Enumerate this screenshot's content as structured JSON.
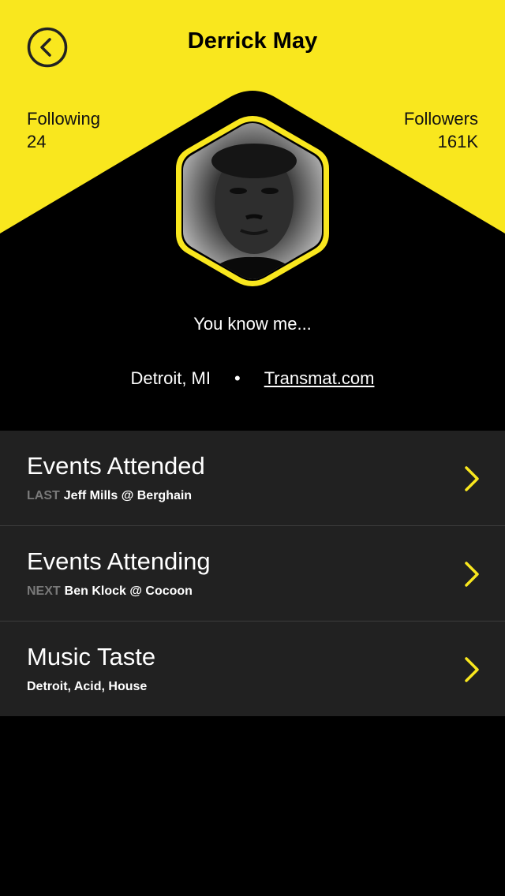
{
  "colors": {
    "accent": "#F9E71E",
    "background": "#000000",
    "row": "#212121"
  },
  "header": {
    "title": "Derrick May",
    "back_icon": "chevron-left-icon"
  },
  "stats": {
    "following": {
      "label": "Following",
      "value": "24"
    },
    "followers": {
      "label": "Followers",
      "value": "161K"
    }
  },
  "profile": {
    "tagline": "You know me...",
    "location": "Detroit, MI",
    "separator": "•",
    "website": "Transmat.com"
  },
  "menu": [
    {
      "title": "Events Attended",
      "prefix": "LAST",
      "detail": "Jeff Mills @ Berghain"
    },
    {
      "title": "Events Attending",
      "prefix": "NEXT",
      "detail": "Ben Klock @ Cocoon"
    },
    {
      "title": "Music Taste",
      "prefix": "",
      "detail": "Detroit, Acid, House"
    }
  ]
}
